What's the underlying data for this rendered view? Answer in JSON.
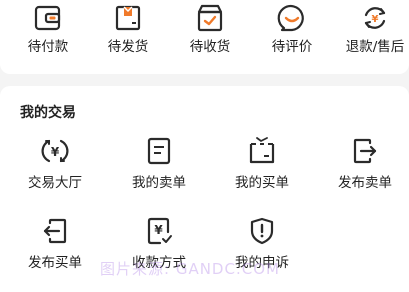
{
  "orders": {
    "items": [
      {
        "label": "待付款",
        "icon": "wallet-icon"
      },
      {
        "label": "待发货",
        "icon": "box-icon"
      },
      {
        "label": "待收货",
        "icon": "delivery-box-icon"
      },
      {
        "label": "待评价",
        "icon": "smile-icon"
      },
      {
        "label": "退款/售后",
        "icon": "refund-icon"
      }
    ]
  },
  "trade": {
    "title": "我的交易",
    "items": [
      {
        "label": "交易大厅",
        "icon": "yuan-exchange-icon"
      },
      {
        "label": "我的卖单",
        "icon": "document-icon"
      },
      {
        "label": "我的买单",
        "icon": "folder-icon"
      },
      {
        "label": "发布卖单",
        "icon": "export-icon"
      },
      {
        "label": "发布买单",
        "icon": "import-icon"
      },
      {
        "label": "收款方式",
        "icon": "yuan-receipt-icon"
      },
      {
        "label": "我的申诉",
        "icon": "shield-alert-icon"
      }
    ]
  },
  "watermark": "图片来源: GANDC.COM",
  "colors": {
    "accent": "#f07a2a",
    "icon": "#2b2b2b"
  }
}
